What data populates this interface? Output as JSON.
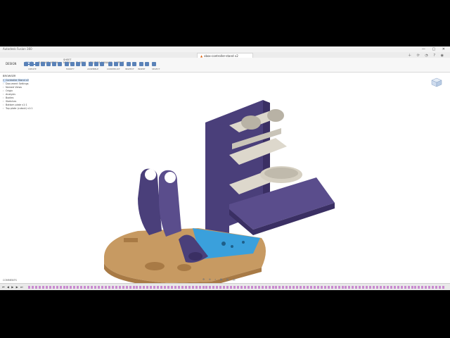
{
  "window": {
    "title": "Autodesk Fusion 360",
    "controls": "— ▢ ✕"
  },
  "document_tab": {
    "label": "xbox-controller-stand v2"
  },
  "toolbar": {
    "workspace": "DESIGN",
    "tabs": [
      "SOLID",
      "SURFACE",
      "MESH",
      "SHEET METAL",
      "PLASTIC",
      "UTILITIES",
      "MANAGE",
      "INSPECT"
    ],
    "groups": [
      "CREATE",
      "MODIFY",
      "ASSEMBLE",
      "CONSTRUCT",
      "INSPECT",
      "INSERT",
      "SELECT"
    ]
  },
  "browser": {
    "title": "BROWSER",
    "items": [
      {
        "label": "Controller Stand v2"
      },
      {
        "label": "Document Settings"
      },
      {
        "label": "Named Views"
      },
      {
        "label": "Origin"
      },
      {
        "label": "Analysis"
      },
      {
        "label": "Bodies"
      },
      {
        "label": "Sketches"
      },
      {
        "label": "Bottom plate v1:1"
      },
      {
        "label": "Top plate (cutout) v1:1"
      }
    ]
  },
  "comments": {
    "label": "COMMENTS"
  },
  "colors": {
    "purple": "#4a3f7a",
    "purple_dark": "#3a2f63",
    "wood": "#c79a62",
    "wood_dark": "#a87a45",
    "blue": "#3aa0dc",
    "grey": "#c9c4b8",
    "timeline_feature": "#c98ad0"
  },
  "timeline": {
    "controls": "⏮ ◀ ▶ ▶ ⏭",
    "feature_count": 120
  }
}
